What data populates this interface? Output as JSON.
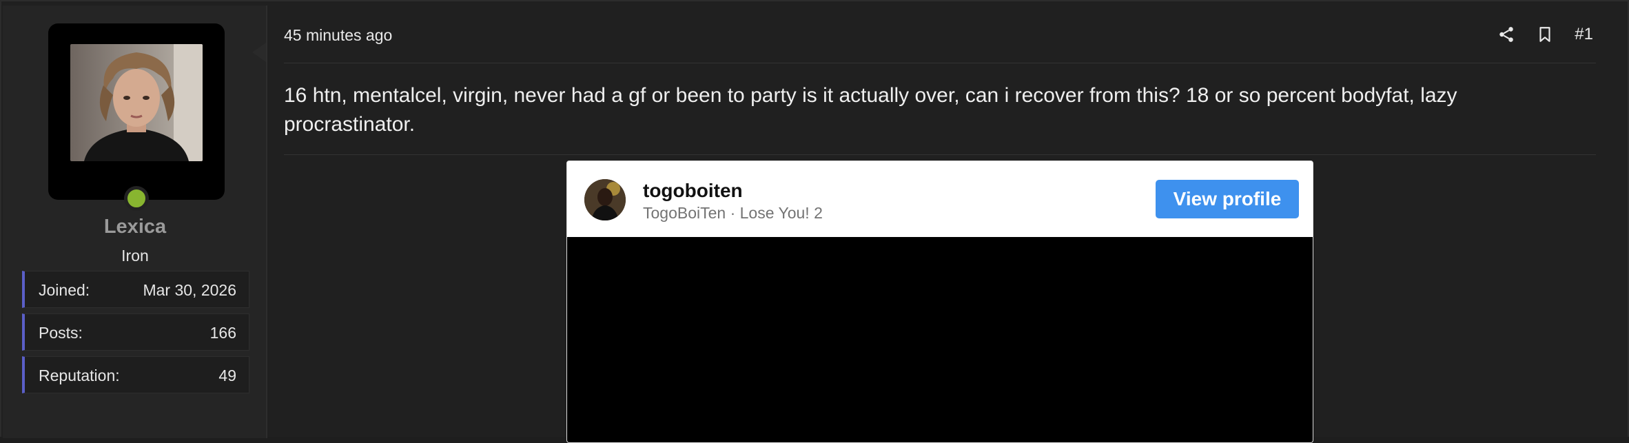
{
  "user": {
    "name": "Lexica",
    "title": "Iron",
    "online": true,
    "stats": [
      {
        "label": "Joined:",
        "value": "Mar 30, 2026"
      },
      {
        "label": "Posts:",
        "value": "166"
      },
      {
        "label": "Reputation:",
        "value": "49"
      }
    ]
  },
  "post": {
    "time": "45 minutes ago",
    "number": "#1",
    "body": "16 htn, mentalcel, virgin, never had a gf or been to party is it actually over, can i recover from this? 18 or so percent bodyfat, lazy procrastinator."
  },
  "embed": {
    "username": "togoboiten",
    "subtitle": "TogoBoiTen · Lose You! 2",
    "button_label": "View profile"
  },
  "icons": {
    "share": "share-icon",
    "bookmark": "bookmark-icon"
  },
  "colors": {
    "online": "#88b530",
    "stat_accent": "#5b5fc8",
    "button": "#3e91ee"
  }
}
